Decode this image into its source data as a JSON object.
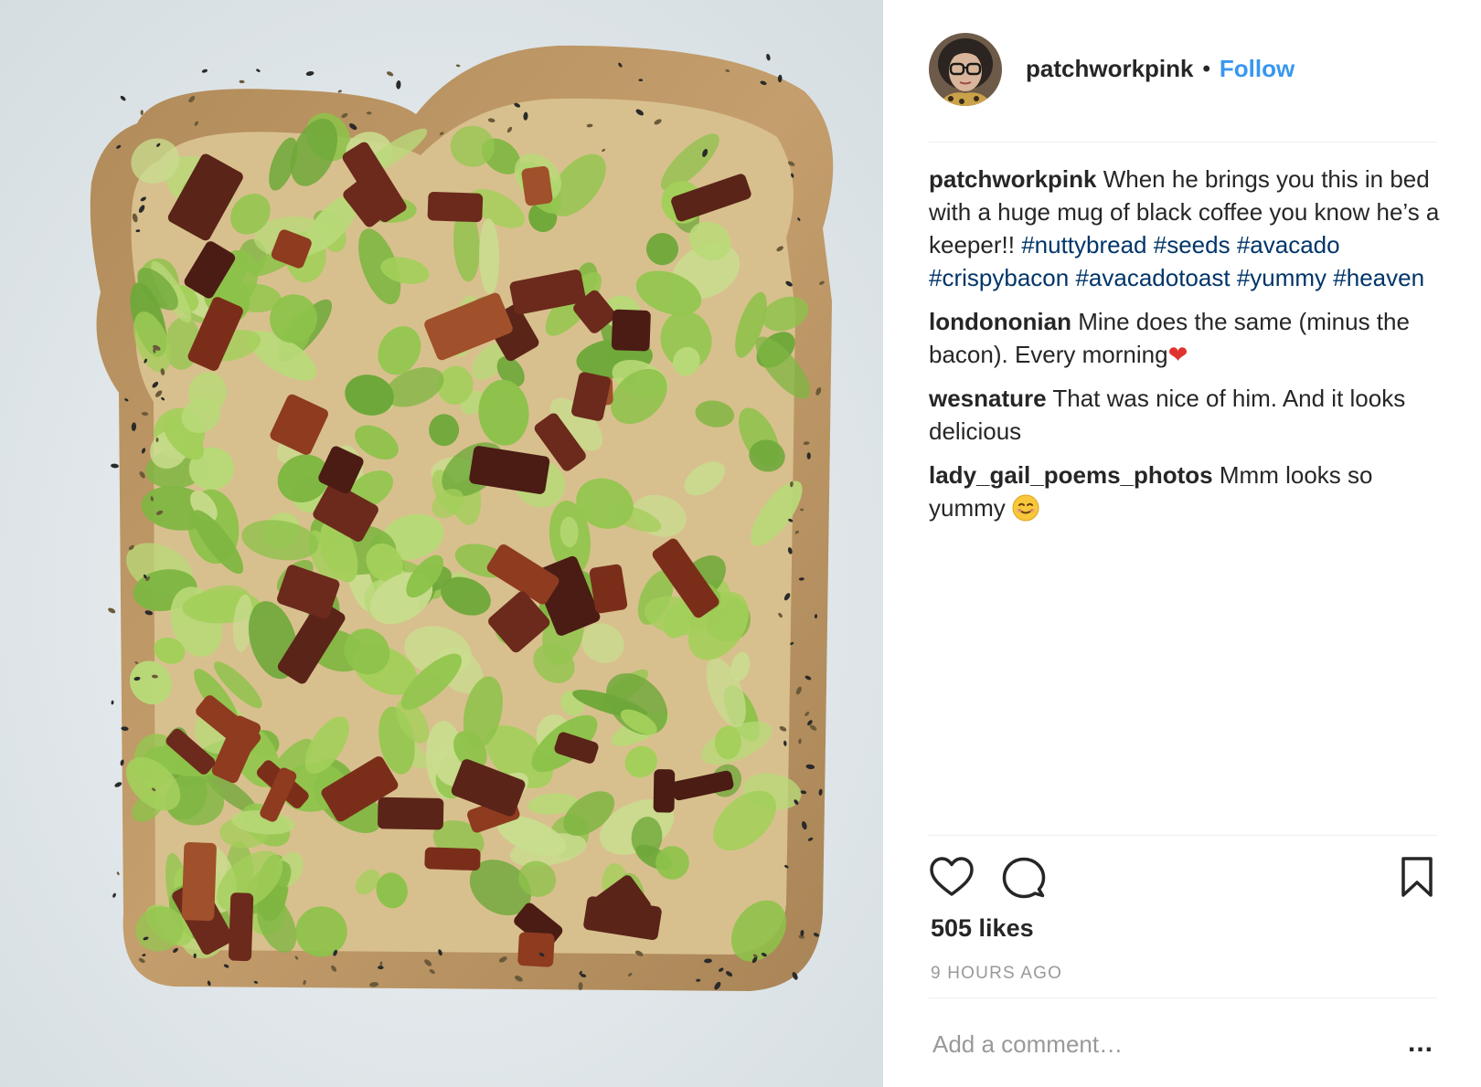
{
  "post": {
    "photo_icon": "avocado-bacon-toast-photo",
    "author": {
      "username": "patchworkpink",
      "avatar_icon": "profile-avatar",
      "follow_label": "Follow",
      "separator": "•"
    },
    "comments": [
      {
        "user": "patchworkpink",
        "text": "When he brings you this in bed with a huge mug of black coffee you know he’s a keeper!!",
        "hashtags": [
          "#nuttybread",
          "#seeds",
          "#avacado",
          "#crispybacon",
          "#avacadotoast",
          "#yummy",
          "#heaven"
        ]
      },
      {
        "user": "londononian",
        "text": "Mine does the same (minus the bacon). Every morning",
        "emoji": "❤"
      },
      {
        "user": "wesnature",
        "text": "That was nice of him. And it looks delicious"
      },
      {
        "user": "lady_gail_poems_photos",
        "text": "Mmm looks so yummy",
        "emoji_icon": "smiling-face-emoji"
      }
    ],
    "actions": {
      "like_icon": "heart-icon",
      "comment_icon": "comment-bubble-icon",
      "save_icon": "bookmark-icon"
    },
    "likes": "505 likes",
    "timestamp": "9 HOURS AGO",
    "add_comment": {
      "placeholder": "Add a comment…",
      "more_label": "..."
    },
    "colors": {
      "link_blue": "#3897f0",
      "hashtag_blue": "#003569",
      "text": "#262626",
      "muted": "#999999"
    }
  }
}
